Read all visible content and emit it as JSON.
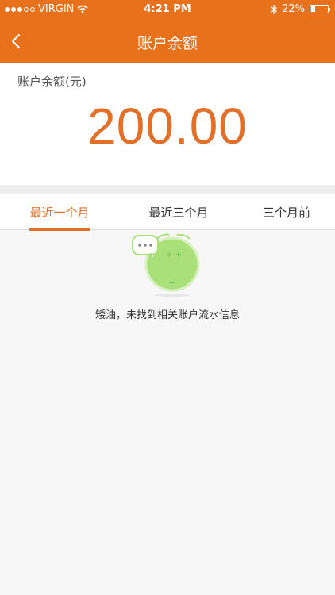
{
  "status_bar": {
    "carrier": "VIRGIN",
    "time": "4:21 PM",
    "battery_percent": "22%",
    "battery_level": 0.22
  },
  "nav": {
    "title": "账户余额",
    "back_icon": "chevron-left-icon"
  },
  "balance": {
    "label": "账户余额(元)",
    "amount": "200.00"
  },
  "tabs": [
    {
      "label": "最近一个月",
      "active": true
    },
    {
      "label": "最近三个月",
      "active": false
    },
    {
      "label": "三个月前",
      "active": false
    }
  ],
  "empty_state": {
    "icon": "empty-face-chat-icon",
    "message": "矮油，未找到相关账户流水信息"
  },
  "colors": {
    "header_bg": "#e8711c",
    "accent": "#e0702a",
    "illustration_green": "#a9e07a"
  }
}
